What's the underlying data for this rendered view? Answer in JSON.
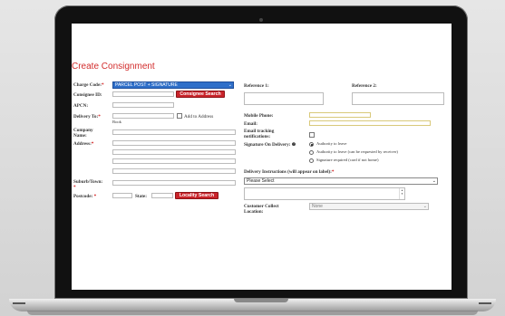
{
  "form": {
    "title": "Create Consignment",
    "charge_code": {
      "label": "Charge Code:",
      "required": "*",
      "value": "PARCEL POST + SIGNATURE"
    },
    "consignee_id": {
      "label": "Consignee ID:",
      "button": "Consignee Search"
    },
    "apcn": {
      "label": "APCN:"
    },
    "delivery_to": {
      "label": "Delivery To:",
      "required": "*",
      "hint": "Book",
      "checkbox_label": "Add to Address"
    },
    "company_name": {
      "label": "Company Name:"
    },
    "address": {
      "label": "Address:",
      "required": "*"
    },
    "suburb": {
      "label": "Suburb/Town:",
      "required": "*"
    },
    "postcode": {
      "label": "Postcode:",
      "required": "*",
      "state_label": "State:",
      "button": "Locality Search"
    },
    "reference1": {
      "label": "Reference 1:"
    },
    "reference2": {
      "label": "Reference 2:"
    },
    "mobile_phone": {
      "label": "Mobile Phone:"
    },
    "email": {
      "label": "Email:"
    },
    "email_tracking": {
      "label": "Email tracking notifications:"
    },
    "signature": {
      "label": "Signature On Delivery:",
      "info": "❷",
      "options": [
        "Authority to leave",
        "Authority to leave (can be requested by receiver)",
        "Signature required (card if not home)"
      ],
      "selected_index": 0
    },
    "delivery_instructions": {
      "label": "Delivery Instructions (will appear on label):",
      "required": "*",
      "value": "Please Select"
    },
    "customer_collect": {
      "label": "Customer Collect Location:",
      "value": "None"
    }
  }
}
